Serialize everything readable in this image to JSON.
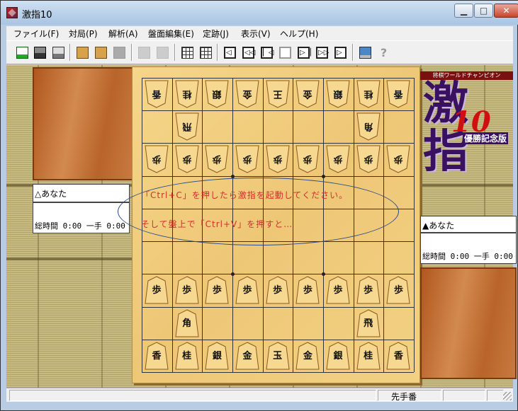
{
  "window": {
    "title": "激指10",
    "controls": [
      "minimize-icon",
      "maximize-icon",
      "close-icon"
    ]
  },
  "menu": [
    "ファイル(F)",
    "対局(P)",
    "解析(A)",
    "盤面編集(E)",
    "定跡(J)",
    "表示(V)",
    "ヘルプ(H)"
  ],
  "toolbar": {
    "icons": [
      "new-doc-icon",
      "save-icon",
      "print-icon",
      "board-icon",
      "board-flip-icon",
      "disabled-icon",
      "disabled-icon",
      "disabled-icon",
      "grid-icon",
      "grid-alt-icon",
      "back-all-icon",
      "back-many-icon",
      "back-one-icon",
      "stop-icon",
      "forward-one-icon",
      "forward-many-icon",
      "forward-all-icon",
      "screen-icon",
      "help-icon"
    ]
  },
  "logo": {
    "banner": "将棋ワールドチャンピオン",
    "big": "激指",
    "number": "10",
    "edition": "優勝記念版"
  },
  "players": {
    "gote": {
      "name": "△あなた",
      "time_label": "総時間",
      "time": "0:00",
      "move_label": "一手",
      "move_time": "0:00"
    },
    "sente": {
      "name": "▲あなた",
      "time_label": "総時間",
      "time": "0:00",
      "move_label": "一手",
      "move_time": "0:00"
    }
  },
  "board": {
    "gote_back": [
      "香",
      "桂",
      "銀",
      "金",
      "王",
      "金",
      "銀",
      "桂",
      "香"
    ],
    "gote_rook": "飛",
    "gote_bishop": "角",
    "pawn": "歩",
    "sente_back": [
      "香",
      "桂",
      "銀",
      "金",
      "玉",
      "金",
      "銀",
      "桂",
      "香"
    ],
    "sente_rook": "飛",
    "sente_bishop": "角"
  },
  "annotation": {
    "line1": "「Ctrl+C」を押したら激指を起動してください。",
    "line2": "そして盤上で「Ctrl+V」を押すと…"
  },
  "status": {
    "turn": "先手番"
  }
}
